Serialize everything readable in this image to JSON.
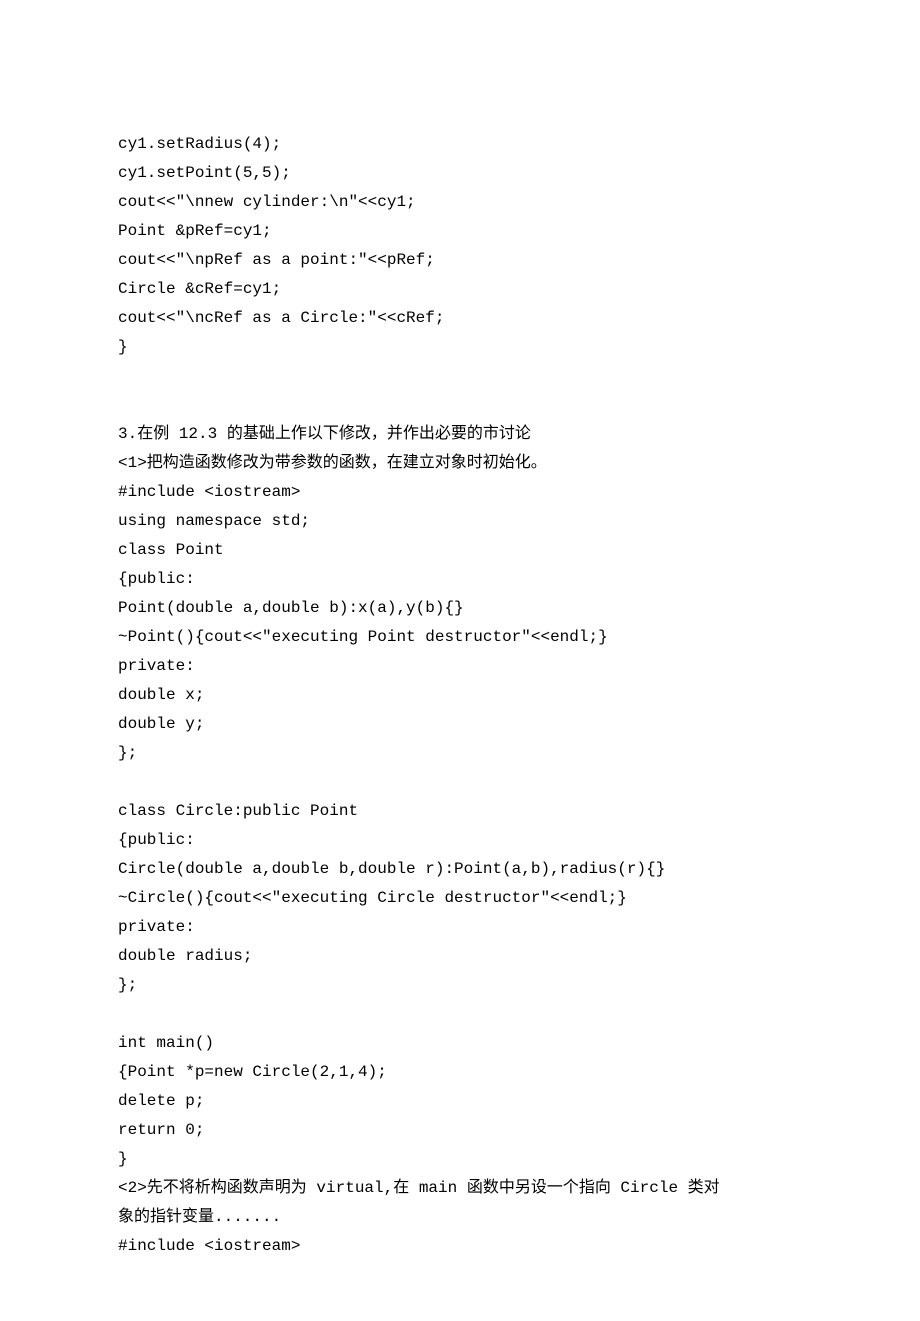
{
  "lines": [
    "cy1.setRadius(4);",
    "cy1.setPoint(5,5);",
    "cout<<\"\\nnew cylinder:\\n\"<<cy1;",
    "Point &pRef=cy1;",
    "cout<<\"\\npRef as a point:\"<<pRef;",
    "Circle &cRef=cy1;",
    "cout<<\"\\ncRef as a Circle:\"<<cRef;",
    "}",
    "",
    "",
    "3.在例 12.3 的基础上作以下修改，并作出必要的市讨论",
    "<1>把构造函数修改为带参数的函数，在建立对象时初始化。",
    "#include <iostream>",
    "using namespace std;",
    "class Point",
    "{public:",
    "Point(double a,double b):x(a),y(b){}",
    "~Point(){cout<<\"executing Point destructor\"<<endl;}",
    "private:",
    "double x;",
    "double y;",
    "};",
    "",
    "class Circle:public Point",
    "{public:",
    "Circle(double a,double b,double r):Point(a,b),radius(r){}",
    "~Circle(){cout<<\"executing Circle destructor\"<<endl;}",
    "private:",
    "double radius;",
    "};",
    "",
    "int main()",
    "{Point *p=new Circle(2,1,4);",
    "delete p;",
    "return 0;",
    "}",
    "<2>先不将析构函数声明为 virtual,在 main 函数中另设一个指向 Circle 类对",
    "象的指针变量.......",
    "#include <iostream>"
  ]
}
